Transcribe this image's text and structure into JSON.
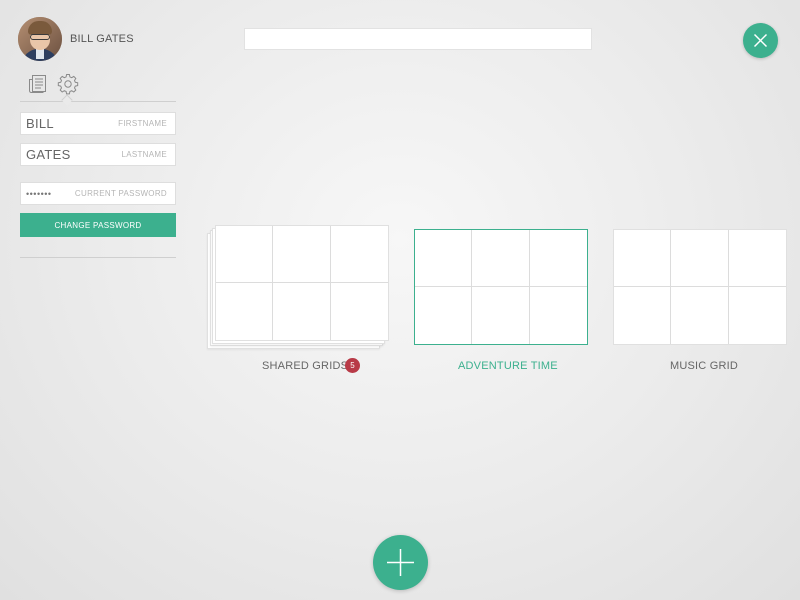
{
  "user": {
    "name": "BILL GATES"
  },
  "profile_form": {
    "firstname_value": "BILL",
    "firstname_label": "FIRSTNAME",
    "lastname_value": "GATES",
    "lastname_label": "LASTNAME",
    "password_value": "•••••••",
    "password_label": "CURRENT PASSWORD",
    "change_password_label": "CHANGE PASSWORD"
  },
  "sidebar_tabs": [
    {
      "icon": "articles-icon",
      "active": false
    },
    {
      "icon": "gear-icon",
      "active": true
    }
  ],
  "search": {
    "value": "",
    "placeholder": ""
  },
  "grids": [
    {
      "label": "SHARED GRIDS",
      "badge": "5",
      "stacked": true,
      "active": false
    },
    {
      "label": "ADVENTURE TIME",
      "stacked": false,
      "active": true
    },
    {
      "label": "MUSIC GRID",
      "stacked": false,
      "active": false
    }
  ],
  "colors": {
    "accent": "#3cb08e",
    "badge": "#b83a47",
    "background": "#ececec"
  },
  "icons": {
    "close": "close-icon",
    "add": "plus-icon"
  }
}
